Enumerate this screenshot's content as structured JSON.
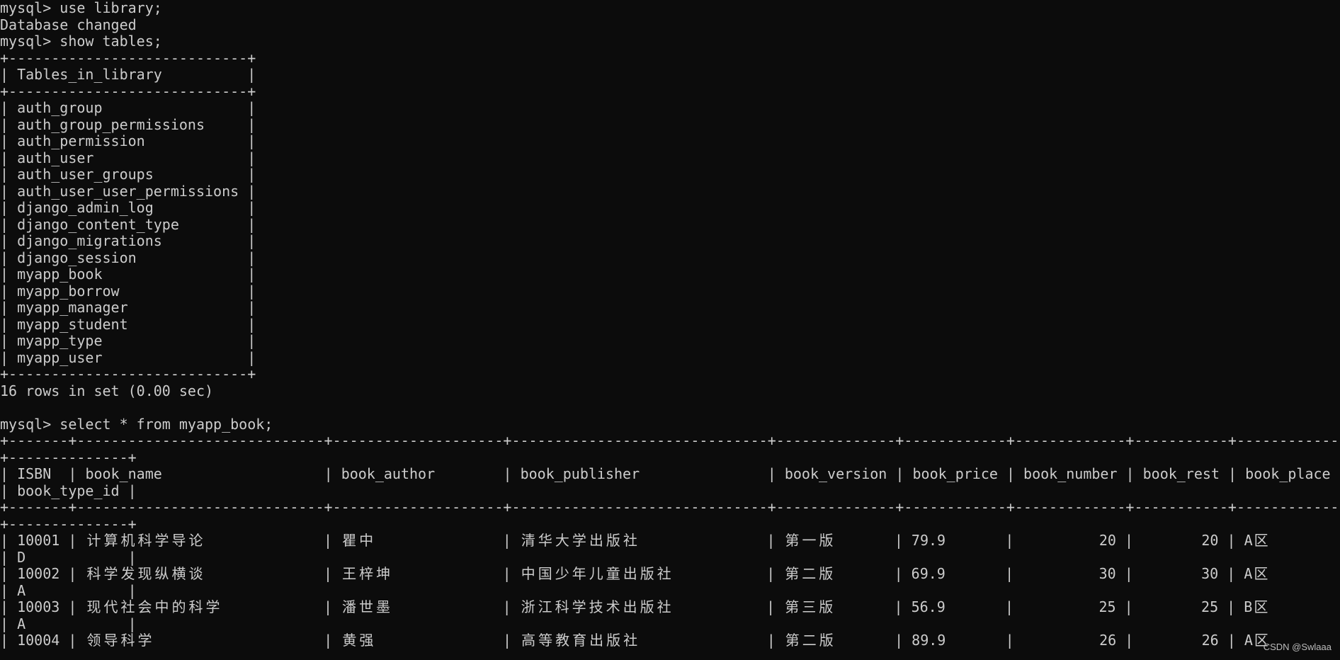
{
  "terminal": {
    "colors": {
      "background": "#0c0c0c",
      "text": "#cccccc"
    },
    "columns": 157,
    "session": [
      {
        "prompt": "mysql> ",
        "command": "use library;"
      },
      {
        "output": "Database changed"
      },
      {
        "prompt": "mysql> ",
        "command": "show tables;"
      },
      {
        "table": {
          "headers": [
            "Tables_in_library"
          ],
          "align": [
            "left"
          ],
          "widths": [
            26
          ],
          "rows": [
            [
              "auth_group"
            ],
            [
              "auth_group_permissions"
            ],
            [
              "auth_permission"
            ],
            [
              "auth_user"
            ],
            [
              "auth_user_groups"
            ],
            [
              "auth_user_user_permissions"
            ],
            [
              "django_admin_log"
            ],
            [
              "django_content_type"
            ],
            [
              "django_migrations"
            ],
            [
              "django_session"
            ],
            [
              "myapp_book"
            ],
            [
              "myapp_borrow"
            ],
            [
              "myapp_manager"
            ],
            [
              "myapp_student"
            ],
            [
              "myapp_type"
            ],
            [
              "myapp_user"
            ]
          ]
        }
      },
      {
        "output": "16 rows in set (0.00 sec)"
      },
      {
        "output": ""
      },
      {
        "prompt": "mysql> ",
        "command": "select * from myapp_book;"
      },
      {
        "table": {
          "headers": [
            "ISBN",
            "book_name",
            "book_author",
            "book_publisher",
            "book_version",
            "book_price",
            "book_number",
            "book_rest",
            "book_place",
            "book_type_id"
          ],
          "align": [
            "left",
            "left",
            "left",
            "left",
            "left",
            "left",
            "right",
            "right",
            "left",
            "left"
          ],
          "widths": [
            5,
            27,
            18,
            28,
            12,
            10,
            11,
            9,
            10,
            12
          ],
          "rows": [
            [
              "10001",
              "计算机科学导论",
              "瞿中",
              "清华大学出版社",
              "第一版",
              "79.9",
              "20",
              "20",
              "A区",
              "D"
            ],
            [
              "10002",
              "科学发现纵横谈",
              "王梓坤",
              "中国少年儿童出版社",
              "第二版",
              "69.9",
              "30",
              "30",
              "A区",
              "A"
            ],
            [
              "10003",
              "现代社会中的科学",
              "潘世墨",
              "浙江科学技术出版社",
              "第三版",
              "56.9",
              "25",
              "25",
              "B区",
              "A"
            ],
            [
              "10004",
              "领导科学",
              "黄强",
              "高等教育出版社",
              "第二版",
              "89.9",
              "26",
              "26",
              "A区",
              ""
            ]
          ]
        }
      }
    ]
  },
  "watermark": "CSDN @Swlaaa"
}
